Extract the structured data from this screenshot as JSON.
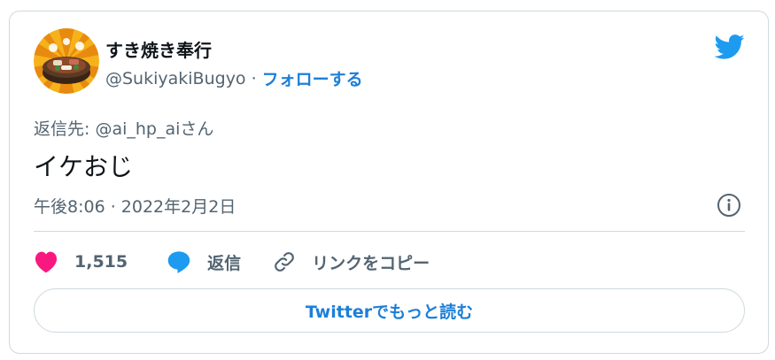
{
  "author": {
    "display_name": "すき焼き奉行",
    "handle": "@SukiyakiBugyo",
    "separator": "·",
    "follow_label": "フォローする"
  },
  "tweet": {
    "reply_to_prefix": "返信先: ",
    "reply_to_handle": "@ai_hp_ai",
    "reply_to_suffix": "さん",
    "text": "イケおじ",
    "timestamp": "午後8:06 · 2022年2月2日"
  },
  "actions": {
    "like_count": "1,515",
    "reply_label": "返信",
    "copy_link_label": "リンクをコピー"
  },
  "read_more_label": "Twitterでもっと読む",
  "icons": {
    "logo": "twitter-bird-icon",
    "info": "info-icon",
    "like": "heart-icon",
    "reply": "reply-bubble-icon",
    "link": "link-icon"
  },
  "colors": {
    "accent": "#1d9bf0",
    "link": "#1d7fd8",
    "like": "#f91880",
    "secondary_text": "#536471",
    "border": "#cfd9de"
  }
}
